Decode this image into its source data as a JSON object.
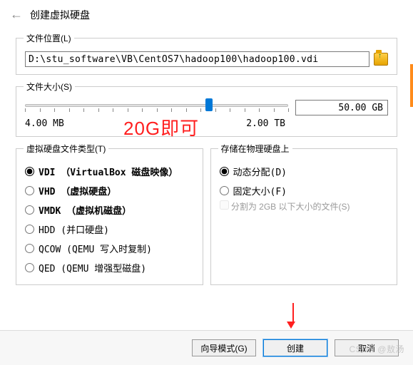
{
  "header": {
    "title": "创建虚拟硬盘"
  },
  "file_location": {
    "legend": "文件位置(L)",
    "path": "D:\\stu_software\\VB\\CentOS7\\hadoop100\\hadoop100.vdi"
  },
  "file_size": {
    "legend": "文件大小(S)",
    "value": "50.00 GB",
    "min_label": "4.00 MB",
    "max_label": "2.00 TB",
    "thumb_percent": 70
  },
  "annotation": "20G即可",
  "disk_type": {
    "legend": "虚拟硬盘文件类型(T)",
    "options": [
      {
        "label": "VDI （VirtualBox 磁盘映像）",
        "bold": true,
        "checked": true
      },
      {
        "label": "VHD （虚拟硬盘）",
        "bold": true,
        "checked": false
      },
      {
        "label": "VMDK （虚拟机磁盘）",
        "bold": true,
        "checked": false
      },
      {
        "label": "HDD (并口硬盘)",
        "bold": false,
        "checked": false
      },
      {
        "label": "QCOW (QEMU 写入时复制)",
        "bold": false,
        "checked": false
      },
      {
        "label": "QED (QEMU 增强型磁盘)",
        "bold": false,
        "checked": false
      }
    ]
  },
  "storage": {
    "legend": "存储在物理硬盘上",
    "options": [
      {
        "label": "动态分配(D)",
        "checked": true
      },
      {
        "label": "固定大小(F)",
        "checked": false
      }
    ],
    "split_label": "分割为 2GB 以下大小的文件(S)"
  },
  "footer": {
    "wizard": "向导模式(G)",
    "create": "创建",
    "cancel": "取消"
  },
  "watermark": "CSDN @敖汤"
}
